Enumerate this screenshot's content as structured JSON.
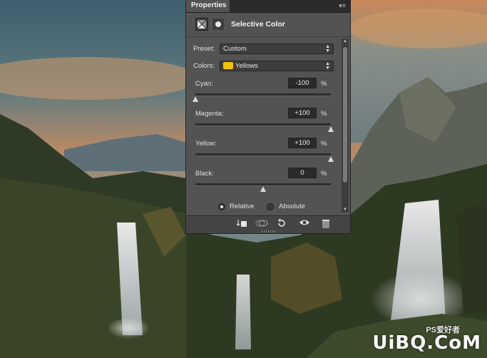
{
  "panel": {
    "tab_label": "Properties",
    "title": "Selective Color",
    "preset_label": "Preset:",
    "preset_value": "Custom",
    "colors_label": "Colors:",
    "colors_value": "Yellows",
    "colors_swatch": "#f2c400",
    "sliders": [
      {
        "label": "Cyan:",
        "value": "-100",
        "unit": "%",
        "fraction": 0.0
      },
      {
        "label": "Magenta:",
        "value": "+100",
        "unit": "%",
        "fraction": 1.0
      },
      {
        "label": "Yellow:",
        "value": "+100",
        "unit": "%",
        "fraction": 1.0
      },
      {
        "label": "Black:",
        "value": "0",
        "unit": "%",
        "fraction": 0.5
      }
    ],
    "method": {
      "relative_label": "Relative",
      "absolute_label": "Absolute",
      "selected": "Relative"
    }
  },
  "watermark": {
    "top": "PS爱好者",
    "bottom": "UiBQ.CoM"
  },
  "colors": {
    "panel_bg": "#535353",
    "sky_orange": "#d9935e",
    "sky_blue": "#4f6f7c"
  }
}
